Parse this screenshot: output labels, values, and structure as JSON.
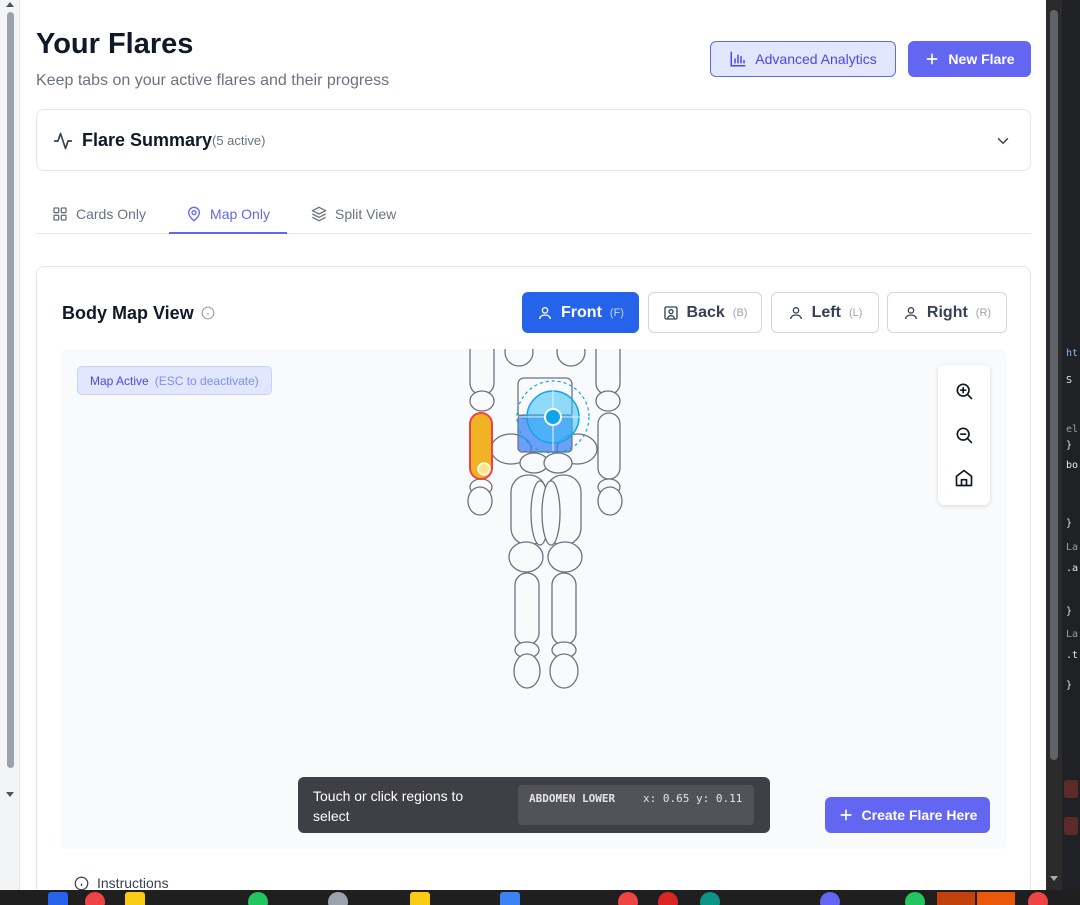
{
  "header": {
    "title": "Your Flares",
    "subtitle": "Keep tabs on your active flares and their progress",
    "analytics_label": "Advanced Analytics",
    "new_flare_label": "New Flare"
  },
  "summary": {
    "title": "Flare Summary",
    "count": "(5 active)"
  },
  "tabs": [
    {
      "label": "Cards Only",
      "icon": "grid-icon",
      "active": false
    },
    {
      "label": "Map Only",
      "icon": "map-pin-icon",
      "active": true
    },
    {
      "label": "Split View",
      "icon": "layers-icon",
      "active": false
    }
  ],
  "map": {
    "title": "Body Map View",
    "views": [
      {
        "label": "Front",
        "key": "(F)",
        "active": true
      },
      {
        "label": "Back",
        "key": "(B)",
        "active": false
      },
      {
        "label": "Left",
        "key": "(L)",
        "active": false
      },
      {
        "label": "Right",
        "key": "(R)",
        "active": false
      }
    ],
    "active_badge": "Map Active",
    "active_badge_hint": "(ESC to deactivate)",
    "hint_text": "Touch or click regions to select",
    "region_label": "ABDOMEN LOWER",
    "coords_label": "x: 0.65 y: 0.11",
    "create_label": "Create Flare Here",
    "highlight_color": "#f0b323",
    "selection_color": "#0ea5e9"
  },
  "instructions_label": "Instructions",
  "colors": {
    "accent": "#6366f1",
    "primary_blue": "#2563eb"
  }
}
